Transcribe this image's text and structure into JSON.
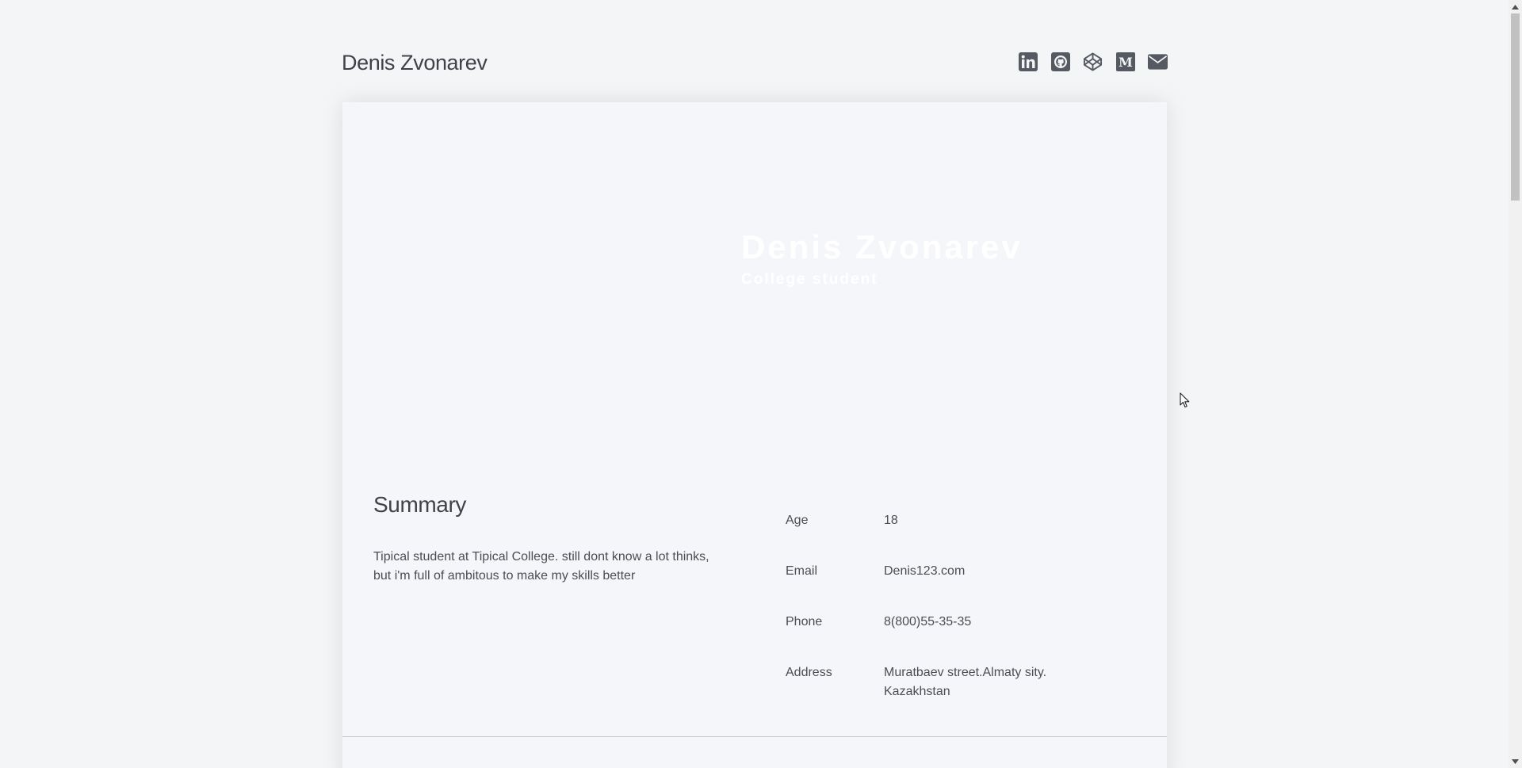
{
  "header": {
    "site_title": "Denis Zvonarev",
    "social_icons": [
      "linkedin-icon",
      "github-icon",
      "codepen-icon",
      "medium-icon",
      "email-icon"
    ]
  },
  "hero": {
    "name": "Denis Zvonarev",
    "role": "College student"
  },
  "summary": {
    "title": "Summary",
    "text": "Tipical student at Tipical College. still dont know a lot thinks, but i'm full of ambitous to make my skills better"
  },
  "info": [
    {
      "label": "Age",
      "value": "18"
    },
    {
      "label": "Email",
      "value": "Denis123.com"
    },
    {
      "label": "Phone",
      "value": "8(800)55-35-35"
    },
    {
      "label": "Address",
      "value": "Muratbaev street.Almaty sity. Kazakhstan"
    }
  ],
  "colors": {
    "background": "#f4f5f7",
    "card": "#f5f6f9",
    "text": "#3f4249",
    "icon": "#555a62"
  }
}
